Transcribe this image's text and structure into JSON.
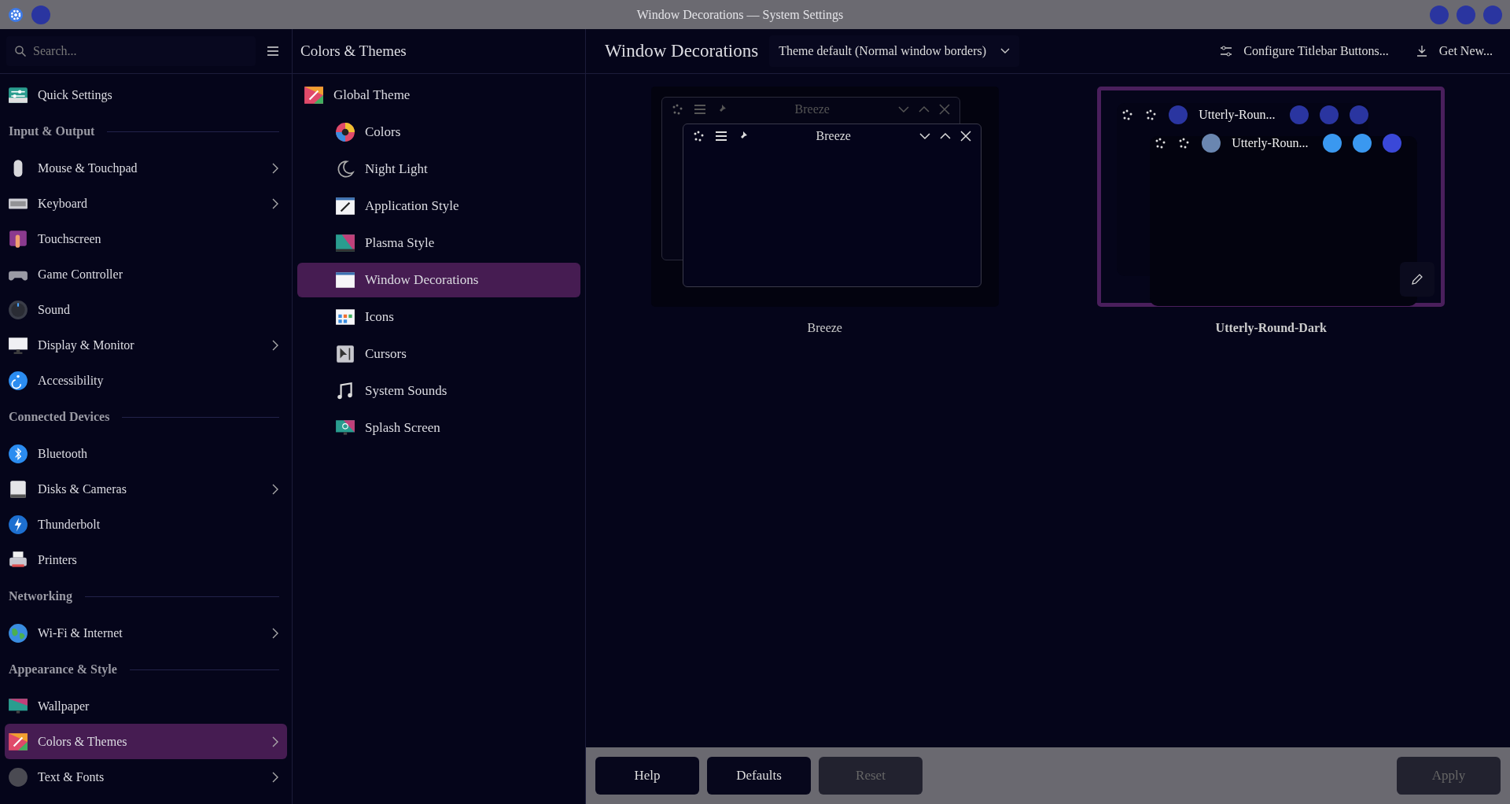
{
  "window": {
    "title": "Window Decorations — System Settings"
  },
  "sidebar": {
    "search": {
      "placeholder": "Search..."
    },
    "entries": [
      {
        "kind": "item",
        "label": "Quick Settings",
        "expandable": false,
        "selected": false
      },
      {
        "kind": "header",
        "label": "Input & Output"
      },
      {
        "kind": "item",
        "label": "Mouse & Touchpad",
        "expandable": true,
        "selected": false
      },
      {
        "kind": "item",
        "label": "Keyboard",
        "expandable": true,
        "selected": false
      },
      {
        "kind": "item",
        "label": "Touchscreen",
        "expandable": false,
        "selected": false
      },
      {
        "kind": "item",
        "label": "Game Controller",
        "expandable": false,
        "selected": false
      },
      {
        "kind": "item",
        "label": "Sound",
        "expandable": false,
        "selected": false
      },
      {
        "kind": "item",
        "label": "Display & Monitor",
        "expandable": true,
        "selected": false
      },
      {
        "kind": "item",
        "label": "Accessibility",
        "expandable": false,
        "selected": false
      },
      {
        "kind": "header",
        "label": "Connected Devices"
      },
      {
        "kind": "item",
        "label": "Bluetooth",
        "expandable": false,
        "selected": false
      },
      {
        "kind": "item",
        "label": "Disks & Cameras",
        "expandable": true,
        "selected": false
      },
      {
        "kind": "item",
        "label": "Thunderbolt",
        "expandable": false,
        "selected": false
      },
      {
        "kind": "item",
        "label": "Printers",
        "expandable": false,
        "selected": false
      },
      {
        "kind": "header",
        "label": "Networking"
      },
      {
        "kind": "item",
        "label": "Wi-Fi & Internet",
        "expandable": true,
        "selected": false
      },
      {
        "kind": "header",
        "label": "Appearance & Style"
      },
      {
        "kind": "item",
        "label": "Wallpaper",
        "expandable": false,
        "selected": false
      },
      {
        "kind": "item",
        "label": "Colors & Themes",
        "expandable": true,
        "selected": true
      },
      {
        "kind": "item",
        "label": "Text & Fonts",
        "expandable": true,
        "selected": false
      }
    ]
  },
  "category": {
    "title": "Colors & Themes",
    "items": [
      {
        "label": "Global Theme",
        "selected": false,
        "children": [
          {
            "label": "Colors",
            "selected": false
          },
          {
            "label": "Night Light",
            "selected": false
          },
          {
            "label": "Application Style",
            "selected": false
          },
          {
            "label": "Plasma Style",
            "selected": false
          },
          {
            "label": "Window Decorations",
            "selected": true
          },
          {
            "label": "Icons",
            "selected": false
          },
          {
            "label": "Cursors",
            "selected": false
          },
          {
            "label": "System Sounds",
            "selected": false
          },
          {
            "label": "Splash Screen",
            "selected": false
          }
        ]
      }
    ]
  },
  "page": {
    "title": "Window Decorations",
    "border_size": {
      "value": "Theme default (Normal window borders)"
    },
    "toolbar": [
      "Configure Titlebar Buttons...",
      "Get New..."
    ],
    "themes": [
      {
        "kind": "breeze",
        "name": "Breeze",
        "selected": false,
        "inactive_title": "Breeze",
        "active_title": "Breeze"
      },
      {
        "kind": "rounded",
        "name": "Utterly-Round-Dark",
        "selected": true,
        "inactive_title": "Utterly-Roun...",
        "active_title": "Utterly-Roun..."
      }
    ]
  },
  "footer": {
    "buttons": [
      {
        "label": "Help",
        "disabled": false
      },
      {
        "label": "Defaults",
        "disabled": false
      },
      {
        "label": "Reset",
        "disabled": true
      },
      {
        "label": "Apply",
        "disabled": true
      }
    ]
  }
}
